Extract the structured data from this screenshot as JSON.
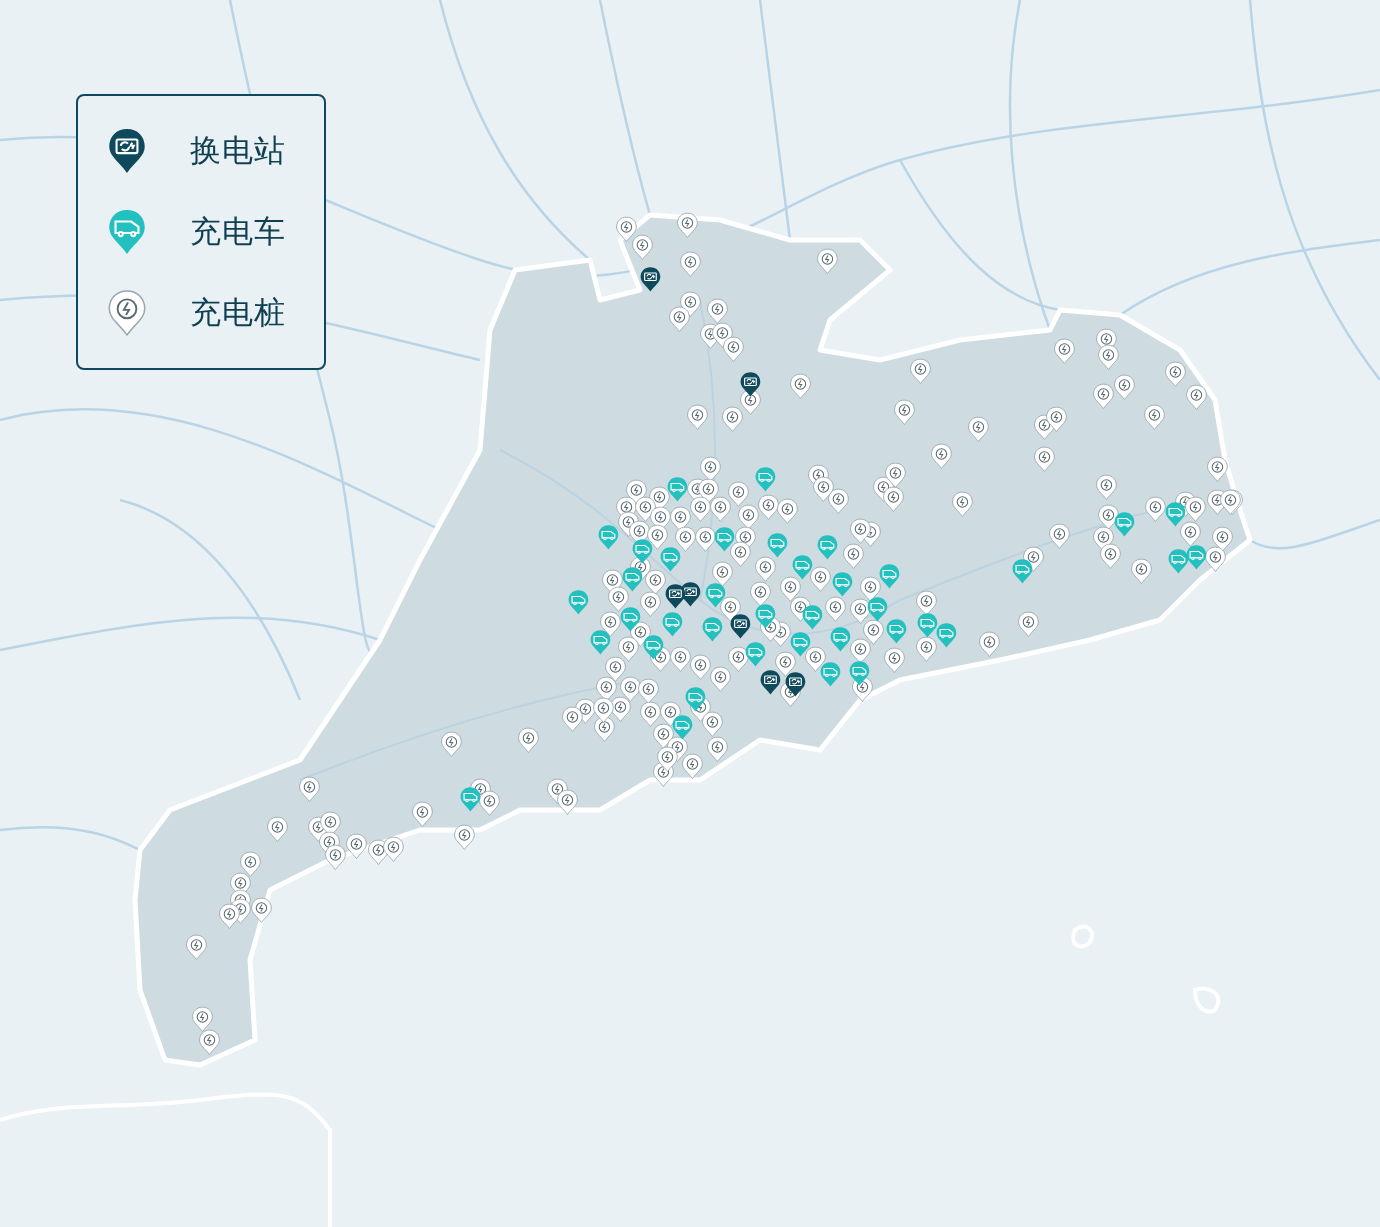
{
  "legend": {
    "items": [
      {
        "kind": "swap_station",
        "label": "换电站"
      },
      {
        "kind": "charging_car",
        "label": "充电车"
      },
      {
        "kind": "charging_pile",
        "label": "充电桩"
      }
    ]
  }
}
